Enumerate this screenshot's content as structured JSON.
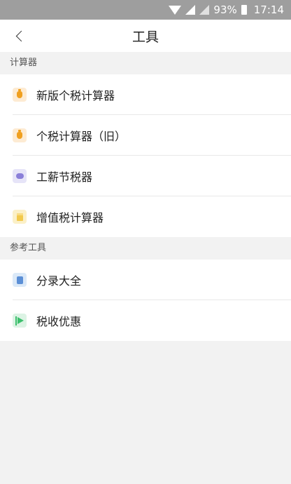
{
  "status_bar": {
    "battery": "93%",
    "time": "17:14"
  },
  "nav": {
    "title": "工具"
  },
  "sections": [
    {
      "header": "计算器",
      "items": [
        {
          "label": "新版个税计算器",
          "icon": "money-bag-icon"
        },
        {
          "label": "个税计算器（旧）",
          "icon": "money-bag-icon"
        },
        {
          "label": "工薪节税器",
          "icon": "piggy-bank-icon"
        },
        {
          "label": "增值税计算器",
          "icon": "calculator-icon"
        }
      ]
    },
    {
      "header": "参考工具",
      "items": [
        {
          "label": "分录大全",
          "icon": "document-icon"
        },
        {
          "label": "税收优惠",
          "icon": "flag-icon"
        }
      ]
    }
  ],
  "colors": {
    "status_bar": "#9e9e9e",
    "page_bg": "#f2f2f2",
    "money_icon": "#f0a020",
    "piggy_icon": "#8a7fd9",
    "calc_icon": "#f2c94c",
    "doc_icon": "#5b8fd6",
    "flag_icon": "#3cbf6c"
  }
}
